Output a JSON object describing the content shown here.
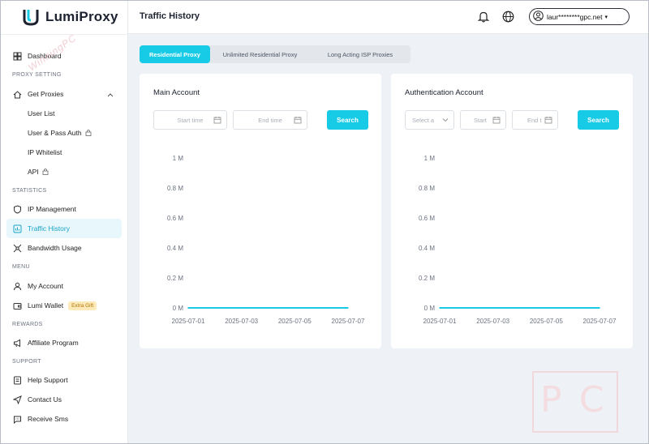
{
  "app": {
    "name": "LumiProxy",
    "brand_color": "#17cbe6",
    "accent_text": "#1aa5c9"
  },
  "sidebar": {
    "dashboard": "Dashboard",
    "section_proxy": "PROXY SETTING",
    "get_proxies": "Get Proxies",
    "user_list": "User List",
    "user_pass_auth": "User & Pass Auth",
    "ip_whitelist": "IP Whitelist",
    "api": "API",
    "section_statistics": "STATISTICS",
    "ip_management": "IP Management",
    "traffic_history": "Traffic History",
    "bandwidth_usage": "Bandwidth Usage",
    "section_menu": "MENU",
    "my_account": "My Account",
    "lumi_wallet": "Lumi Wallet",
    "extra_gift": "Extra Gift",
    "section_rewards": "REWARDS",
    "affiliate_program": "Affiliate Program",
    "section_support": "SUPPORT",
    "help_support": "Help Support",
    "contact_us": "Contact Us",
    "receive_sms": "Receive Sms"
  },
  "header": {
    "title": "Traffic History",
    "icons": [
      "bell-icon",
      "globe-icon",
      "user-icon"
    ],
    "user": "laur********gpc.net"
  },
  "tabs": {
    "residential": "Residential Proxy",
    "unlimited": "Unlimited Residential Proxy",
    "isp": "Long Acting ISP Proxies"
  },
  "main_account": {
    "title": "Main Account",
    "start_placeholder": "Start time",
    "end_placeholder": "End time",
    "search": "Search"
  },
  "auth_account": {
    "title": "Authentication Account",
    "select_placeholder": "Select a",
    "start_placeholder": "Start",
    "end_placeholder": "End t",
    "search": "Search"
  },
  "chart_data": [
    {
      "type": "line",
      "title": "Main Account",
      "x": [
        "2025-07-01",
        "2025-07-02",
        "2025-07-03",
        "2025-07-04",
        "2025-07-05",
        "2025-07-06",
        "2025-07-07"
      ],
      "x_tick_labels": [
        "2025-07-01",
        "2025-07-03",
        "2025-07-05",
        "2025-07-07"
      ],
      "y_tick_labels": [
        "0 M",
        "0.2 M",
        "0.4 M",
        "0.6 M",
        "0.8 M",
        "1 M"
      ],
      "series": [
        {
          "values": [
            0,
            0,
            0,
            0,
            0,
            0,
            0
          ],
          "color": "#17cbe6"
        }
      ],
      "ylim": [
        0,
        1
      ],
      "grid": false
    },
    {
      "type": "line",
      "title": "Authentication Account",
      "x": [
        "2025-07-01",
        "2025-07-02",
        "2025-07-03",
        "2025-07-04",
        "2025-07-05",
        "2025-07-06",
        "2025-07-07"
      ],
      "x_tick_labels": [
        "2025-07-01",
        "2025-07-03",
        "2025-07-05",
        "2025-07-07"
      ],
      "y_tick_labels": [
        "0 M",
        "0.2 M",
        "0.4 M",
        "0.6 M",
        "0.8 M",
        "1 M"
      ],
      "series": [
        {
          "values": [
            0,
            0,
            0,
            0,
            0,
            0,
            0
          ],
          "color": "#17cbe6"
        }
      ],
      "ylim": [
        0,
        1
      ],
      "grid": false
    }
  ],
  "watermark": {
    "text": "WinningPC"
  }
}
